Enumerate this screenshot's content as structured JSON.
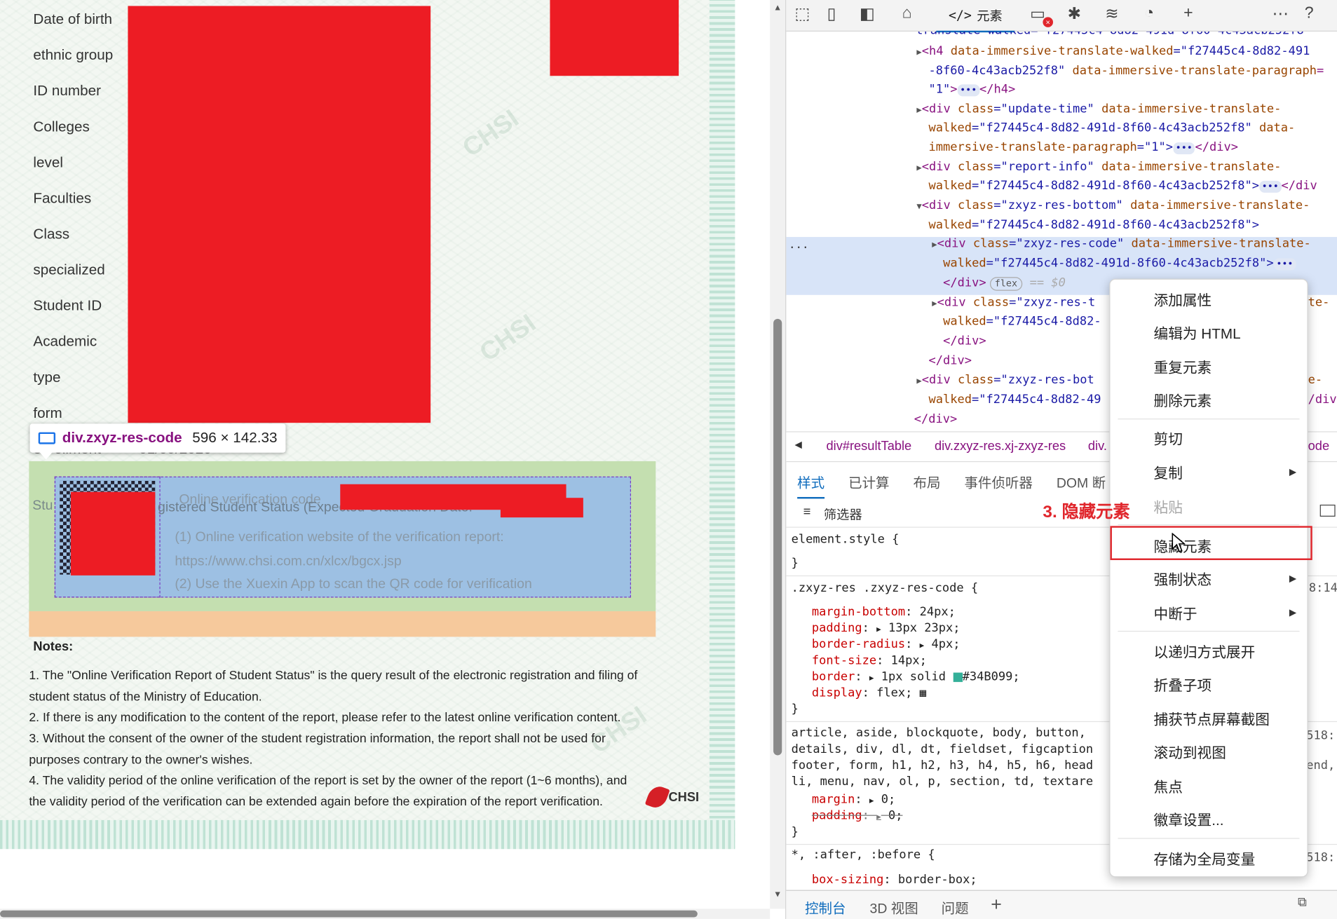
{
  "certificate": {
    "field_labels": [
      "Date of birth",
      "ethnic group",
      "ID number",
      "Colleges",
      "level",
      "Faculties",
      "Class",
      "specialized",
      "Student ID",
      "Academic",
      "type",
      "form",
      "enrollment",
      "dates",
      "Stu"
    ],
    "partial_value": "01/09/2020",
    "online_code_label": "Online verification code",
    "status_text": "gistered Student Status (Expected Graduation Date:",
    "verify_line1": "(1) Online verification website of the verification report:",
    "verify_url": "https://www.chsi.com.cn/xlcx/bgcx.jsp",
    "verify_line2": "(2) Use the Xuexin App to scan the QR code for verification",
    "notes_title": "Notes:",
    "notes": [
      "1. The \"Online Verification Report of Student Status\" is the query result of the electronic registration and filing of",
      "student status of the Ministry of Education.",
      "2. If there is any modification to the content of the report, please refer to the latest online verification content.",
      "3. Without the consent of the owner of the student registration information, the report shall not be used for",
      "purposes contrary to the owner's wishes.",
      "4. The validity period of the online verification of the report is set by the owner of the report (1~6 months), and",
      "the validity period of the verification can be extended again before the expiration of the report verification."
    ],
    "logo_text": "CHSI",
    "watermark": "CHSI"
  },
  "inspect_tooltip": {
    "selector": "div.zxyz-res-code",
    "size": "596 × 142.33"
  },
  "devtools": {
    "toolbar": {
      "elements_tab": "元素",
      "icons": [
        "inspect-icon",
        "device-icon",
        "sidebar-icon",
        "home-icon",
        "code-icon",
        "console-icon",
        "bug-icon",
        "wifi-icon",
        "performance-icon",
        "add-icon",
        "more-icon",
        "help-icon"
      ]
    },
    "dom": {
      "line0": "translate-walked=\"f27445c4-8d82-491d-8f60-4c43acb252f8\"",
      "l1a": "<h4 ",
      "l1b": "data-immersive-translate-walked",
      "l1c": "=\"f27445c4-8d82-491",
      "l2a": "-8f60-4c43acb252f8\" ",
      "l2b": "data-immersive-translate-paragraph",
      "l2c": "=",
      "l3a": "\"1\"",
      "l3b": "</h4>",
      "l4a": "<div ",
      "l4b": "class",
      "l4c": "=\"update-time\" ",
      "l4d": "data-immersive-translate-",
      "l5a": "walked",
      "l5b": "=\"f27445c4-8d82-491d-8f60-4c43acb252f8\" ",
      "l5c": "data-",
      "l6a": "immersive-translate-paragraph",
      "l6b": "=\"1\">",
      "l6c": "</div>",
      "l7a": "<div ",
      "l7b": "class",
      "l7c": "=\"report-info\" ",
      "l7d": "data-immersive-translate-",
      "l8a": "walked",
      "l8b": "=\"f27445c4-8d82-491d-8f60-4c43acb252f8\">",
      "l8c": "</div",
      "l9a": "<div ",
      "l9b": "class",
      "l9c": "=\"zxyz-res-bottom\" ",
      "l9d": "data-immersive-translate-",
      "l10a": "walked",
      "l10b": "=\"f27445c4-8d82-491d-8f60-4c43acb252f8\">",
      "l11a": "<div ",
      "l11b": "class",
      "l11c": "=\"zxyz-res-code\" ",
      "l11d": "data-immersive-translate-",
      "l12a": "walked",
      "l12b": "=\"f27445c4-8d82-491d-8f60-4c43acb252f8\">",
      "l13a": "</div>",
      "l13b": "flex",
      "l13c": "== $0",
      "l14a": "<div ",
      "l14b": "class",
      "l14c": "=\"zxyz-res-t",
      "l14d": "te-",
      "l15a": "walked",
      "l15b": "=\"f27445c4-8d82-",
      "l16": "</div>",
      "l17": "</div>",
      "l18a": "<div ",
      "l18b": "class",
      "l18c": "=\"zxyz-res-bot",
      "l18d": "e-",
      "l19a": "walked",
      "l19b": "=\"f27445c4-8d82-49",
      "l19c": "/div",
      "l20": "</div>",
      "ellipsis": "..."
    },
    "breadcrumbs": [
      "div#resultTable",
      "div.zxyz-res.xj-zxyz-res",
      "div.",
      "ode"
    ],
    "style_tabs": [
      "样式",
      "已计算",
      "布局",
      "事件侦听器",
      "DOM 断"
    ],
    "filter_label": "筛选器",
    "css": {
      "r1a": "element.style {",
      "r1b": "}",
      "r2sel": ".zxyz-res .zxyz-res-code {",
      "p1n": "margin-bottom",
      "p1v": "24px;",
      "p2n": "padding",
      "p2v": "13px 23px;",
      "p3n": "border-radius",
      "p3v": "4px;",
      "p4n": "font-size",
      "p4v": "14px;",
      "p5n": "border",
      "p5v": "1px solid",
      "p5c": "#34B099;",
      "p6n": "display",
      "p6v": "flex;",
      "r2end": "}",
      "r2src": "8:14",
      "r3a": "article, aside, blockquote, body, button,",
      "r3b": "details, div, dl, dt, fieldset, figcaption",
      "r3c": "footer, form, h1, h2, h3, h4, h5, h6, head",
      "r3d": "li, menu, nav, ol, p, section, td, textare",
      "r3src": "518:",
      "r3src2": "end,",
      "p7n": "margin",
      "p7v": "0;",
      "p8n": "padding",
      "p8v": "0;",
      "r3end": "}",
      "r4sel": "*, :after, :before {",
      "r4src": "518:",
      "p9n": "box-sizing",
      "p9v": "border-box;"
    },
    "drawer_tabs": [
      "控制台",
      "3D 视图",
      "问题"
    ]
  },
  "context_menu": {
    "items": [
      "添加属性",
      "编辑为 HTML",
      "重复元素",
      "删除元素",
      "剪切",
      "复制",
      "粘贴",
      "隐藏元素",
      "强制状态",
      "中断于",
      "以递归方式展开",
      "折叠子项",
      "捕获节点屏幕截图",
      "滚动到视图",
      "焦点",
      "徽章设置...",
      "存储为全局变量"
    ],
    "annotation": "3. 隐藏元素"
  },
  "colors": {
    "highlight_red": "#e0262c",
    "accent_blue": "#0f6cbd",
    "border_teal": "#34B099"
  }
}
